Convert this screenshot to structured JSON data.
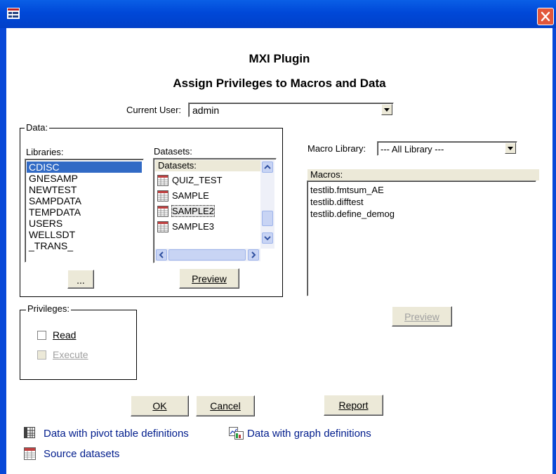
{
  "window": {
    "heading": "MXI Plugin",
    "subheading": "Assign Privileges to Macros and Data"
  },
  "user": {
    "label": "Current User:",
    "value": "admin"
  },
  "data_group": {
    "legend": "Data:",
    "libraries_label": "Libraries:",
    "libraries": [
      "CDISC",
      "GNESAMP",
      "NEWTEST",
      "SAMPDATA",
      "TEMPDATA",
      "USERS",
      "WELLSDT",
      "_TRANS_"
    ],
    "datasets_label": "Datasets:",
    "datasets_header": "Datasets:",
    "datasets": [
      "QUIZ_TEST",
      "SAMPLE",
      "SAMPLE2",
      "SAMPLE3"
    ],
    "browse_button": "...",
    "preview_button": "Preview"
  },
  "macro": {
    "library_label": "Macro Library:",
    "library_value": "--- All Library ---",
    "macros_header": "Macros:",
    "macros": [
      "testlib.fmtsum_AE",
      "testlib.difftest",
      "testlib.define_demog"
    ],
    "preview_button": "Preview"
  },
  "privileges": {
    "legend": "Privileges:",
    "read_label": "Read",
    "execute_label": "Execute"
  },
  "buttons": {
    "ok": "OK",
    "cancel": "Cancel",
    "report": "Report"
  },
  "legend_links": {
    "pivot": "Data with pivot table definitions",
    "graph": "Data with graph definitions",
    "source": "Source datasets"
  }
}
